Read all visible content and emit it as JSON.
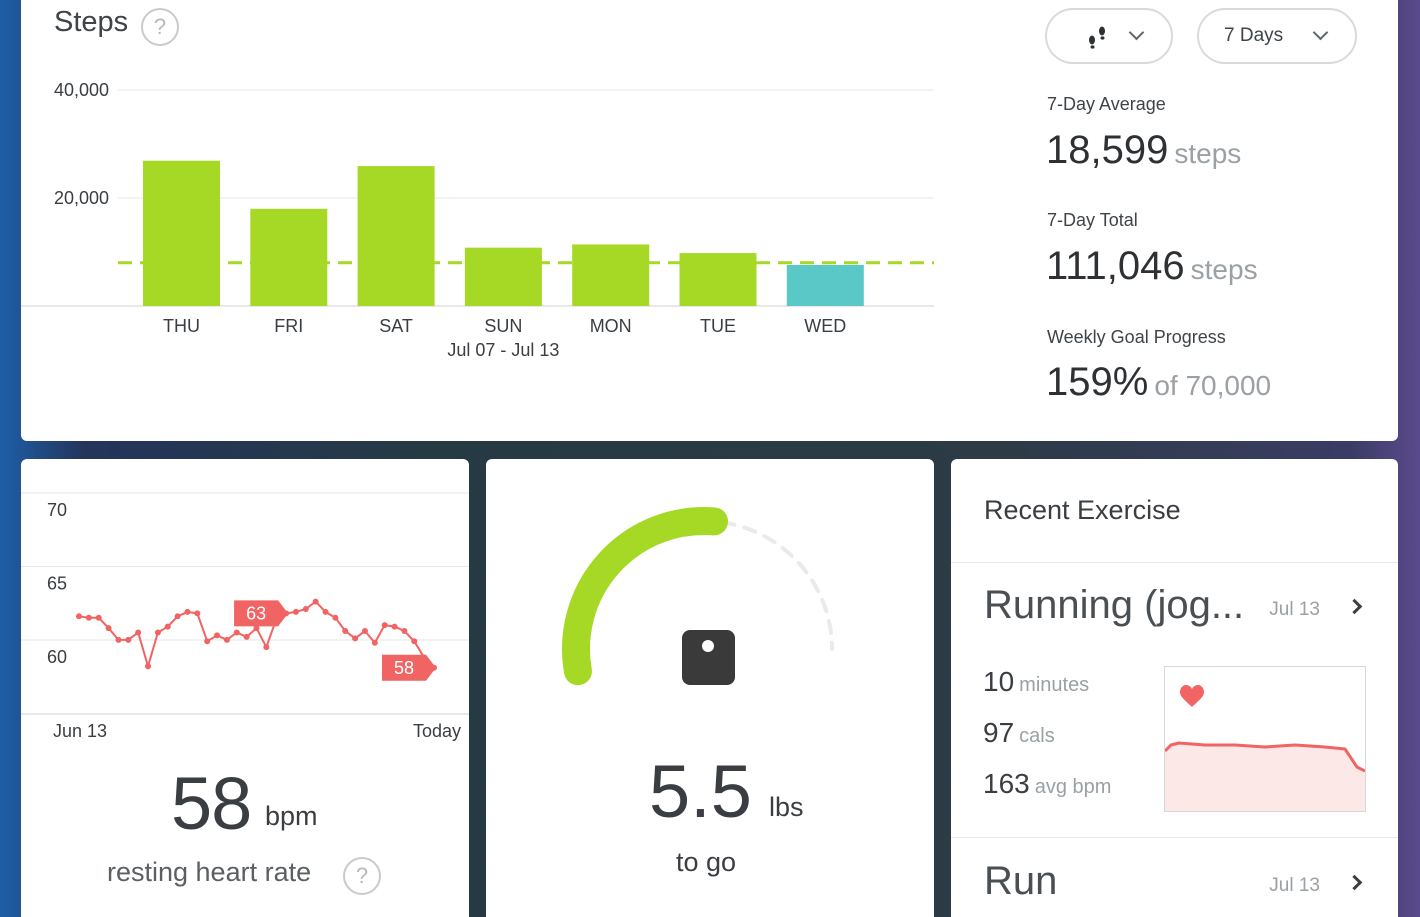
{
  "steps": {
    "title": "Steps",
    "help_icon": "?",
    "activity_icon": "footprints-icon",
    "range_label": "7 Days",
    "stats": {
      "average_label": "7-Day Average",
      "average_value": "18,599",
      "average_unit": "steps",
      "total_label": "7-Day Total",
      "total_value": "111,046",
      "total_unit": "steps",
      "goal_label": "Weekly Goal Progress",
      "goal_value": "159%",
      "goal_unit": "of 70,000"
    },
    "date_range": "Jul 07 - Jul 13",
    "colors": {
      "bar": "#a6d925",
      "today_bar": "#5bc8c8",
      "goal_line": "#a6d925"
    }
  },
  "chart_data": [
    {
      "type": "bar",
      "title": "Steps",
      "categories": [
        "THU",
        "FRI",
        "SAT",
        "SUN",
        "MON",
        "TUE",
        "WED"
      ],
      "values": [
        26900,
        18000,
        25900,
        10800,
        11400,
        9800,
        7600
      ],
      "y_ticks": [
        "40,000",
        "20,000"
      ],
      "ylim": [
        0,
        40000
      ],
      "goal_line": 8000,
      "xlabel": "Jul 07 - Jul 13",
      "highlighted_category": "WED"
    },
    {
      "type": "line",
      "y_ticks": [
        "70",
        "65",
        "60"
      ],
      "ylim": [
        59,
        71
      ],
      "x_labels": [
        "Jun 13",
        "Today"
      ],
      "values": [
        62.7,
        62.6,
        62.6,
        61.9,
        61.1,
        61.1,
        61.6,
        59.3,
        61.6,
        62.0,
        62.7,
        63.0,
        62.9,
        61.0,
        61.4,
        61.1,
        61.6,
        61.3,
        61.9,
        60.6,
        62.5,
        62.9,
        63.0,
        63.2,
        63.7,
        63.0,
        62.6,
        61.7,
        61.2,
        61.7,
        60.9,
        62.1,
        62.0,
        61.7,
        61.0,
        59.9,
        59.2
      ],
      "annotations": [
        {
          "label": "63",
          "index": 21
        },
        {
          "label": "58",
          "index": 36
        }
      ],
      "color": "#f06463"
    }
  ],
  "heart": {
    "value": "58",
    "unit": "bpm",
    "label": "resting heart rate",
    "help_icon": "?"
  },
  "weight": {
    "value": "5.5",
    "unit": "lbs",
    "label": "to go",
    "progress": 0.55,
    "icon": "scale-icon",
    "colors": {
      "progress": "#a6d925",
      "track": "#e8eaeb"
    }
  },
  "exercise": {
    "title": "Recent Exercise",
    "items": [
      {
        "name": "Running (jog...",
        "date": "Jul 13",
        "stats": [
          {
            "value": "10",
            "unit": "minutes"
          },
          {
            "value": "97",
            "unit": "cals"
          },
          {
            "value": "163",
            "unit": "avg bpm"
          }
        ]
      },
      {
        "name": "Run",
        "date": "Jul 13"
      }
    ],
    "mini_chart_icon": "heart-icon",
    "colors": {
      "line": "#f06463",
      "fill": "#fde8e8"
    }
  }
}
